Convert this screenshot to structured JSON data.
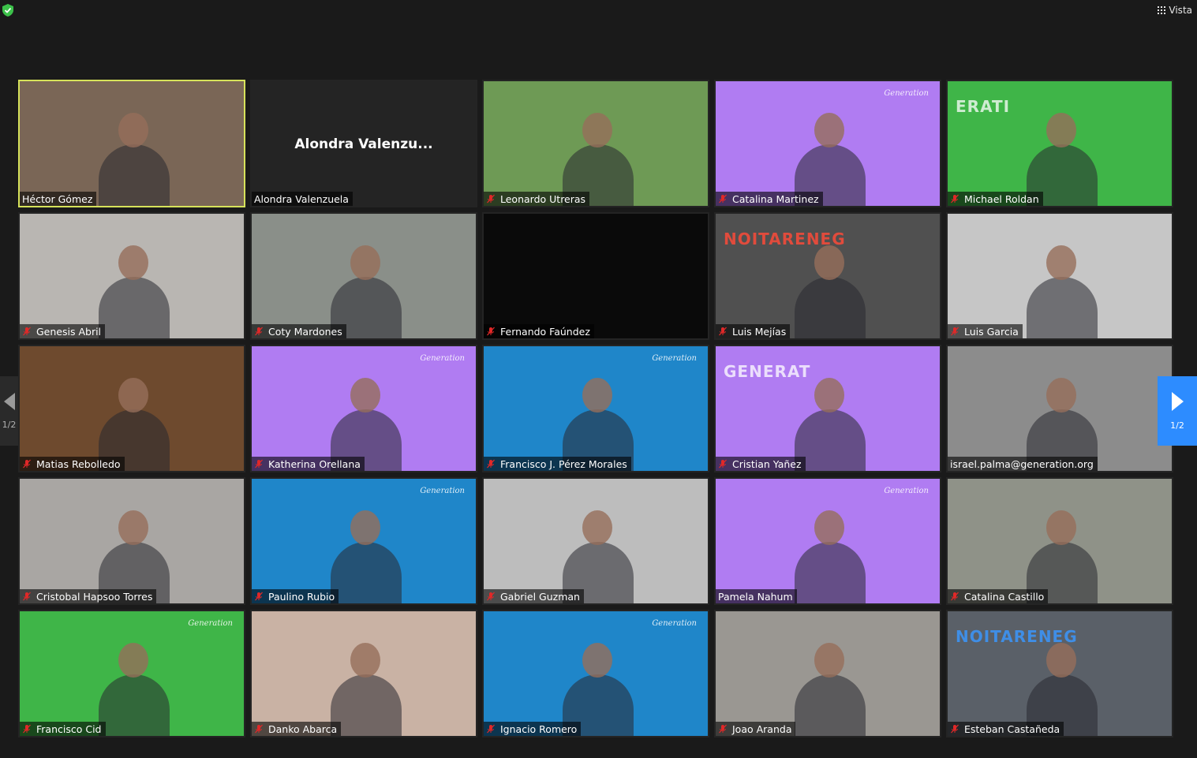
{
  "toolbar": {
    "view_label": "Vista"
  },
  "pagination": {
    "left_page": "1/2",
    "right_page": "1/2"
  },
  "participants": [
    {
      "name": "Héctor Gómez",
      "muted": false,
      "active": true,
      "bg": "#7a6656",
      "video": "room"
    },
    {
      "name": "Alondra Valenzuela",
      "muted": false,
      "active": false,
      "bg": "#242424",
      "video": "off",
      "display_name": "Alondra  Valenzu..."
    },
    {
      "name": "Leonardo Utreras",
      "muted": true,
      "active": false,
      "bg": "#6e9a55",
      "video": "room"
    },
    {
      "name": "Catalina Martinez",
      "muted": true,
      "active": false,
      "bg": "#b07cf2",
      "video": "brand",
      "logo": "Generation"
    },
    {
      "name": "Michael  Roldan",
      "muted": true,
      "active": false,
      "bg": "#3fb548",
      "video": "banner",
      "banner": "ERATI"
    },
    {
      "name": "Genesis Abril",
      "muted": true,
      "active": false,
      "bg": "#b9b6b2",
      "video": "room"
    },
    {
      "name": "Coty Mardones",
      "muted": true,
      "active": false,
      "bg": "#8a8f89",
      "video": "room"
    },
    {
      "name": "Fernando Faúndez",
      "muted": true,
      "active": false,
      "bg": "#0a0a0a",
      "video": "dark"
    },
    {
      "name": "Luis Mejías",
      "muted": true,
      "active": false,
      "bg": "#505050",
      "video": "banner",
      "banner": "NOITARENEG"
    },
    {
      "name": "Luis Garcia",
      "muted": true,
      "active": false,
      "bg": "#c6c6c6",
      "video": "room"
    },
    {
      "name": "Matias Rebolledo",
      "muted": true,
      "active": false,
      "bg": "#6e4a2e",
      "video": "room"
    },
    {
      "name": "Katherina Orellana",
      "muted": true,
      "active": false,
      "bg": "#b07cf2",
      "video": "brand",
      "logo": "Generation"
    },
    {
      "name": "Francisco J. Pérez Morales",
      "muted": true,
      "active": false,
      "bg": "#1f86c9",
      "video": "brand",
      "logo": "Generation"
    },
    {
      "name": "Cristian Yañez",
      "muted": true,
      "active": false,
      "bg": "#b07cf2",
      "video": "banner",
      "banner": "GENERAT"
    },
    {
      "name": "israel.palma@generation.org",
      "muted": false,
      "active": false,
      "bg": "#8c8c8c",
      "video": "room"
    },
    {
      "name": "Cristobal Hapsoo Torres",
      "muted": true,
      "active": false,
      "bg": "#a9a6a3",
      "video": "room"
    },
    {
      "name": "Paulino Rubio",
      "muted": true,
      "active": false,
      "bg": "#1f86c9",
      "video": "brand",
      "logo": "Generation"
    },
    {
      "name": "Gabriel Guzman",
      "muted": true,
      "active": false,
      "bg": "#bdbdbd",
      "video": "room"
    },
    {
      "name": "Pamela Nahum",
      "muted": false,
      "active": false,
      "bg": "#b07cf2",
      "video": "brand",
      "logo": "Generation"
    },
    {
      "name": "Catalina Castillo",
      "muted": true,
      "active": false,
      "bg": "#8f9288",
      "video": "room"
    },
    {
      "name": "Francisco Cid",
      "muted": true,
      "active": false,
      "bg": "#3fb548",
      "video": "brand",
      "logo": "Generation"
    },
    {
      "name": "Danko Abarca",
      "muted": true,
      "active": false,
      "bg": "#c9b2a4",
      "video": "room"
    },
    {
      "name": "Ignacio Romero",
      "muted": true,
      "active": false,
      "bg": "#1f86c9",
      "video": "brand",
      "logo": "Generation"
    },
    {
      "name": "Joao Aranda",
      "muted": true,
      "active": false,
      "bg": "#9a9792",
      "video": "room"
    },
    {
      "name": "Esteban Castañeda",
      "muted": true,
      "active": false,
      "bg": "#5a6068",
      "video": "banner",
      "banner": "NOITARENEG"
    }
  ]
}
